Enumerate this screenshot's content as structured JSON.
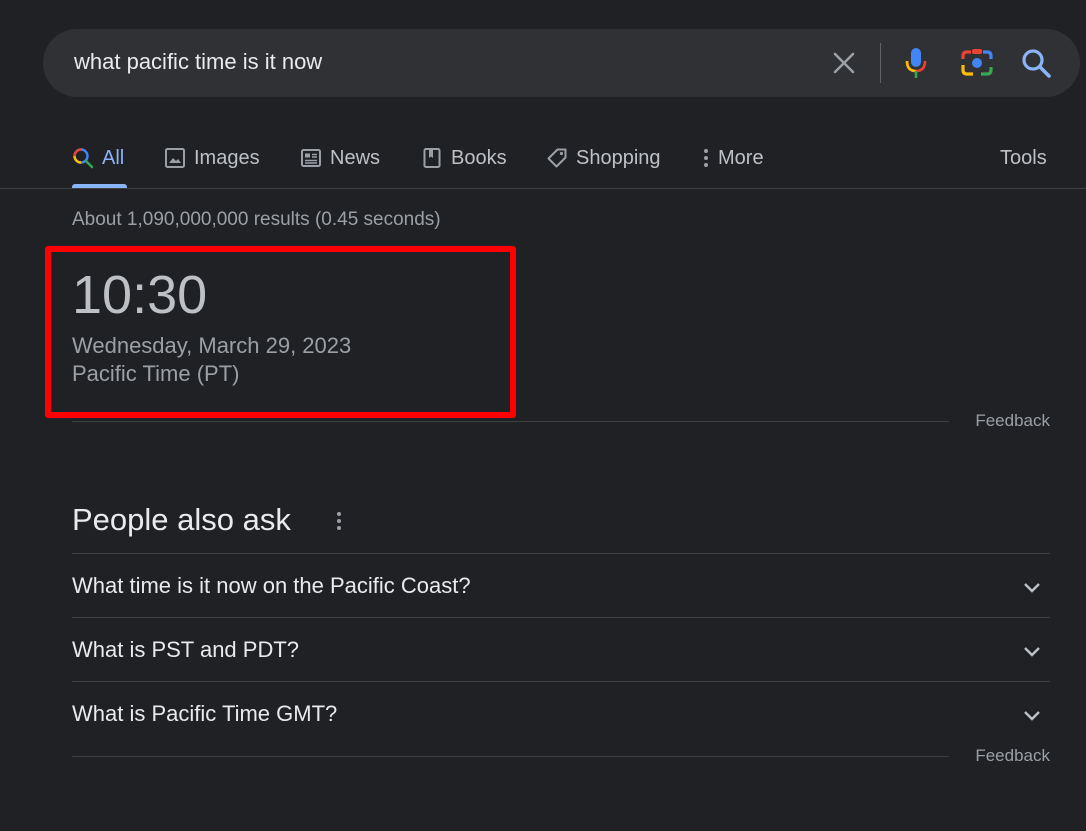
{
  "search": {
    "query": "what pacific time is it now"
  },
  "tabs": [
    {
      "label": "All",
      "icon": "search-icon",
      "active": true
    },
    {
      "label": "Images",
      "icon": "image-icon"
    },
    {
      "label": "News",
      "icon": "news-icon"
    },
    {
      "label": "Books",
      "icon": "book-icon"
    },
    {
      "label": "Shopping",
      "icon": "tag-icon"
    },
    {
      "label": "More",
      "icon": "kebab-icon"
    }
  ],
  "tools_label": "Tools",
  "result_stats": "About 1,090,000,000 results (0.45 seconds)",
  "time_card": {
    "time": "10:30",
    "date": "Wednesday, March 29, 2023",
    "zone": "Pacific Time (PT)",
    "highlight_color": "#ff0000"
  },
  "feedback_label": "Feedback",
  "people_also_ask": {
    "title": "People also ask",
    "questions": [
      "What time is it now on the Pacific Coast?",
      "What is PST and PDT?",
      "What is Pacific Time GMT?"
    ]
  },
  "colors": {
    "background": "#202124",
    "searchbar": "#303134",
    "accent": "#8ab4f8"
  }
}
